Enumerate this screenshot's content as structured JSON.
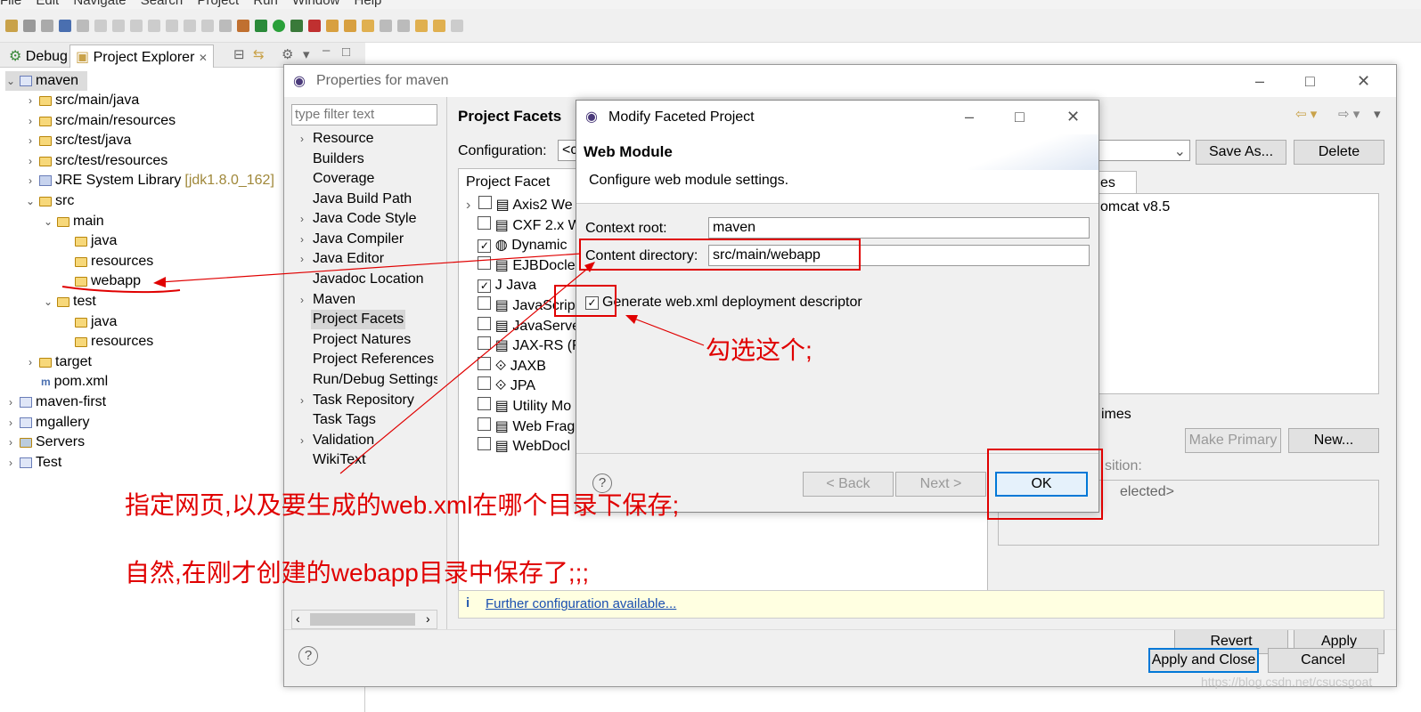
{
  "menu": [
    "File",
    "Edit",
    "Navigate",
    "Search",
    "Project",
    "Run",
    "Window",
    "Help"
  ],
  "tabs": {
    "debug": "Debug",
    "explorer": "Project Explorer"
  },
  "tree": {
    "project": "maven",
    "items": [
      {
        "label": "src/main/java"
      },
      {
        "label": "src/main/resources"
      },
      {
        "label": "src/test/java"
      },
      {
        "label": "src/test/resources"
      },
      {
        "label": "JRE System Library",
        "extra": "[jdk1.8.0_162]"
      },
      {
        "label": "src"
      },
      {
        "label": "main"
      },
      {
        "label": "java"
      },
      {
        "label": "resources"
      },
      {
        "label": "webapp"
      },
      {
        "label": "test"
      },
      {
        "label": "java"
      },
      {
        "label": "resources"
      },
      {
        "label": "target"
      },
      {
        "label": "pom.xml"
      }
    ],
    "others": [
      "maven-first",
      "mgallery",
      "Servers",
      "Test"
    ]
  },
  "props": {
    "title": "Properties for maven",
    "filter_placeholder": "type filter text",
    "nav": [
      "Resource",
      "Builders",
      "Coverage",
      "Java Build Path",
      "Java Code Style",
      "Java Compiler",
      "Java Editor",
      "Javadoc Location",
      "Maven",
      "Project Facets",
      "Project Natures",
      "Project References",
      "Run/Debug Settings",
      "Task Repository",
      "Task Tags",
      "Validation",
      "WikiText"
    ],
    "heading": "Project Facets",
    "config_label": "Configuration:",
    "config_value": "<c",
    "save_as": "Save As...",
    "delete": "Delete",
    "facet_col": "Project Facet",
    "facets": [
      "Axis2 We",
      "CXF 2.x W",
      "Dynamic",
      "EJBDocle",
      "Java",
      "JavaScrip",
      "JavaServe",
      "JAX-RS (F",
      "JAXB",
      "JPA",
      "Utility Mo",
      "Web Frag",
      "WebDocl"
    ],
    "runtimes_tab": "es",
    "runtime": "omcat v8.5",
    "runtimes_label": "imes",
    "make_primary": "Make Primary",
    "new": "New...",
    "composition": "sition:",
    "selected": "elected>",
    "further": "Further configuration available...",
    "revert": "Revert",
    "apply": "Apply",
    "apply_close": "Apply and Close",
    "cancel": "Cancel"
  },
  "modify": {
    "title": "Modify Faceted Project",
    "heading": "Web Module",
    "desc": "Configure web module settings.",
    "context_label": "Context root:",
    "context_value": "maven",
    "content_label": "Content directory:",
    "content_value": "src/main/webapp",
    "generate": "Generate web.xml deployment descriptor",
    "back": "< Back",
    "next": "Next >",
    "ok": "OK"
  },
  "annotations": {
    "check_this": "勾选这个;",
    "specify": "指定网页,以及要生成的web.xml在哪个目录下保存;",
    "naturally": "自然,在刚才创建的webapp目录中保存了;;;"
  },
  "watermark": "https://blog.csdn.net/csucsgoat"
}
